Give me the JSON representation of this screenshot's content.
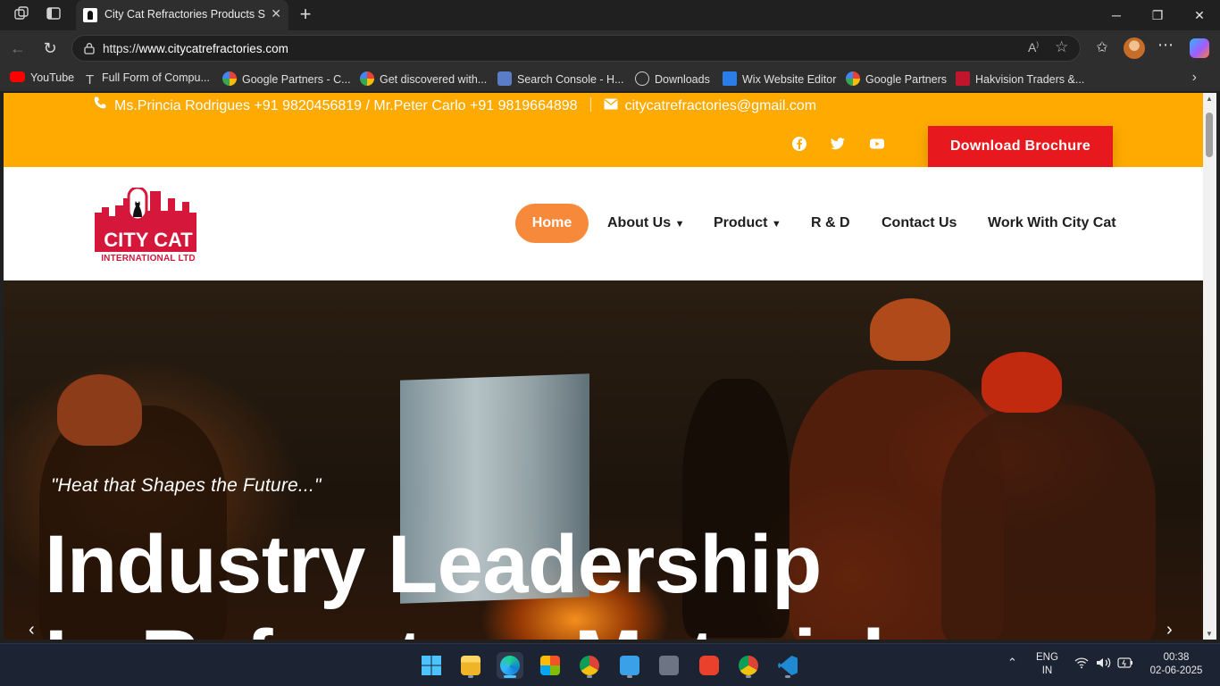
{
  "browser": {
    "tab_title": "City Cat Refractories Products Supplier",
    "url_prefix": "https://",
    "url_host": "www.citycatrefractories.com",
    "bookmarks": [
      "YouTube",
      "Full Form of Compu...",
      "Google Partners - C...",
      "Get discovered with...",
      "Search Console - H...",
      "Downloads",
      "Wix Website Editor",
      "Google Partners",
      "Hakvision Traders &..."
    ]
  },
  "topbar": {
    "contacts": "Ms.Princia Rodrigues +91 9820456819 / Mr.Peter Carlo +91 9819664898",
    "email": "citycatrefractories@gmail.com",
    "brochure_label": "Download Brochure",
    "social_icons": [
      "facebook-icon",
      "twitter-icon",
      "youtube-icon"
    ],
    "bg_color": "#ffaa00",
    "brochure_color": "#e8191e"
  },
  "nav": {
    "logo_main": "CITY CAT",
    "logo_sub": "INTERNATIONAL LTD",
    "items": {
      "home": "Home",
      "about": "About Us",
      "product": "Product",
      "rd": "R & D",
      "contact": "Contact Us",
      "work": "Work With City Cat"
    },
    "active_color": "#f7893b"
  },
  "hero": {
    "tagline": "\"Heat that Shapes the Future...\"",
    "headline": "Industry Leadership",
    "headline_next": "In Refractory Materials"
  },
  "taskbar": {
    "lang": "ENG",
    "region": "IN",
    "time": "00:38",
    "date": "02-06-2025"
  }
}
